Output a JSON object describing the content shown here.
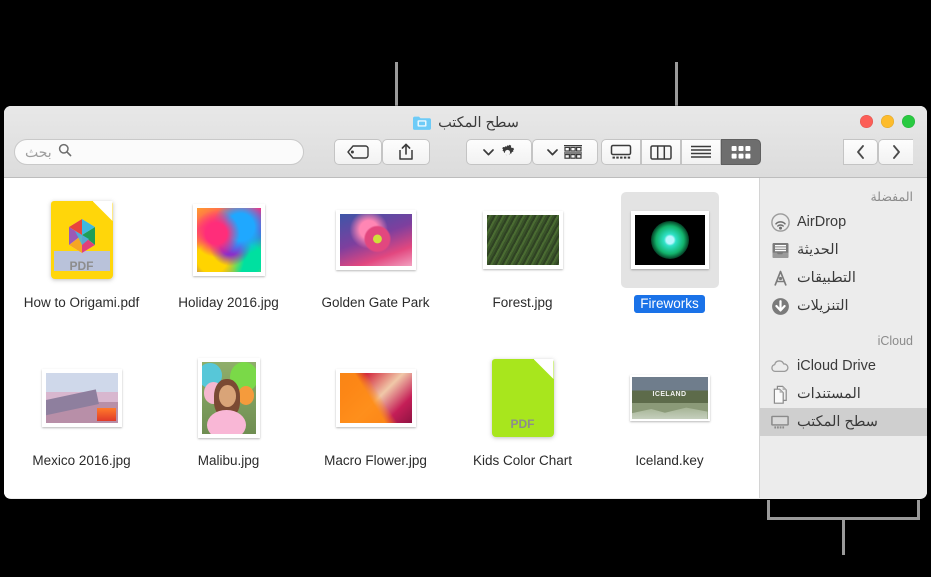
{
  "window": {
    "title": "سطح المكتب",
    "folder_icon": "blue-folder-icon",
    "traffic_lights": [
      "close-red",
      "minimize-yellow",
      "zoom-green"
    ]
  },
  "search": {
    "placeholder": "بحث",
    "value": "",
    "icon": "search-icon"
  },
  "toolbar": {
    "back_label": "❮",
    "forward_label": "❯",
    "buttons": [
      {
        "name": "tag-button",
        "icon": "tag-icon"
      },
      {
        "name": "share-button",
        "icon": "share-icon"
      },
      {
        "name": "action-menu-button",
        "icon": "gear-icon",
        "chevron": "chevron-down-icon"
      },
      {
        "name": "arrange-menu-button",
        "icon": "group-items-icon",
        "chevron": "chevron-down-icon"
      }
    ],
    "view_buttons": [
      {
        "name": "cover-flow-view-button",
        "icon": "cover-flow-icon",
        "active": false
      },
      {
        "name": "column-view-button",
        "icon": "column-view-icon",
        "active": false
      },
      {
        "name": "list-view-button",
        "icon": "list-view-icon",
        "active": false
      },
      {
        "name": "icon-view-button",
        "icon": "icon-view-grid-icon",
        "active": true
      }
    ]
  },
  "sidebar": {
    "sections": [
      {
        "header": "المفضلة",
        "items": [
          {
            "label": "AirDrop",
            "icon": "airdrop-icon",
            "selected": false
          },
          {
            "label": "الحديثة",
            "icon": "recents-tray-icon",
            "selected": false
          },
          {
            "label": "التطبيقات",
            "icon": "applications-icon",
            "selected": false
          },
          {
            "label": "التنزيلات",
            "icon": "downloads-arrow-icon",
            "selected": false
          }
        ]
      },
      {
        "header": "iCloud",
        "items": [
          {
            "label": "iCloud Drive",
            "icon": "cloud-icon",
            "selected": false
          },
          {
            "label": "المستندات",
            "icon": "documents-icon",
            "selected": false
          },
          {
            "label": "سطح المكتب",
            "icon": "desktop-icon",
            "selected": true
          }
        ]
      }
    ]
  },
  "files": {
    "rows": [
      [
        {
          "name": "How to Origami.pdf",
          "kind": "pdf",
          "accent": "#ffd60a",
          "selected": false
        },
        {
          "name": "Holiday 2016.jpg",
          "kind": "photo",
          "orient": "landscape",
          "selected": false
        },
        {
          "name": "Golden Gate Park",
          "kind": "photo",
          "orient": "landscape",
          "selected": false
        },
        {
          "name": "Forest.jpg",
          "kind": "photo",
          "orient": "landscape",
          "selected": false
        },
        {
          "name": "Fireworks",
          "kind": "photo",
          "orient": "landscape",
          "selected": true
        }
      ],
      [
        {
          "name": "Mexico 2016.jpg",
          "kind": "photo",
          "orient": "landscape",
          "selected": false
        },
        {
          "name": "Malibu.jpg",
          "kind": "photo",
          "orient": "portrait",
          "selected": false
        },
        {
          "name": "Macro Flower.jpg",
          "kind": "photo",
          "orient": "landscape",
          "selected": false
        },
        {
          "name": "Kids Color Chart",
          "kind": "pdf",
          "accent": "#a8e61d",
          "selected": false
        },
        {
          "name": "Iceland.key",
          "kind": "photo",
          "orient": "landscape",
          "selected": false
        }
      ]
    ]
  },
  "colors": {
    "selection_blue": "#1a72e8",
    "selection_grey": "#e3e3e3",
    "sidebar_bg": "#ececec",
    "active_view_button": "#6e6e6e",
    "callout_line": "#9a9a9a"
  }
}
